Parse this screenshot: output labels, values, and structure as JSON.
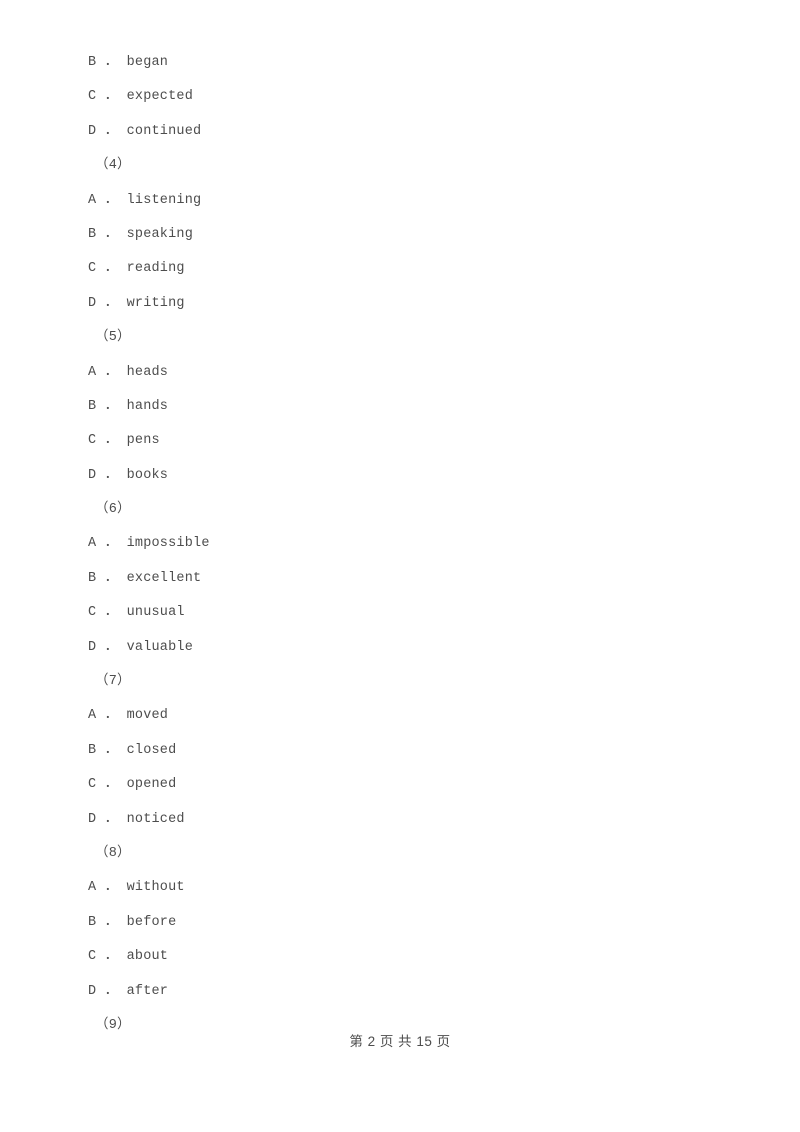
{
  "document": {
    "page_background": "#ffffff",
    "text_color": "#4d4d4d",
    "lines": [
      {
        "kind": "option",
        "text": "B ． began"
      },
      {
        "kind": "option",
        "text": "C ． expected"
      },
      {
        "kind": "option",
        "text": "D ． continued"
      },
      {
        "kind": "qnum",
        "text": "（4）"
      },
      {
        "kind": "option",
        "text": "A ． listening"
      },
      {
        "kind": "option",
        "text": "B ． speaking"
      },
      {
        "kind": "option",
        "text": "C ． reading"
      },
      {
        "kind": "option",
        "text": "D ． writing"
      },
      {
        "kind": "qnum",
        "text": "（5）"
      },
      {
        "kind": "option",
        "text": "A ． heads"
      },
      {
        "kind": "option",
        "text": "B ． hands"
      },
      {
        "kind": "option",
        "text": "C ． pens"
      },
      {
        "kind": "option",
        "text": "D ． books"
      },
      {
        "kind": "qnum",
        "text": "（6）"
      },
      {
        "kind": "option",
        "text": "A ． impossible"
      },
      {
        "kind": "option",
        "text": "B ． excellent"
      },
      {
        "kind": "option",
        "text": "C ． unusual"
      },
      {
        "kind": "option",
        "text": "D ． valuable"
      },
      {
        "kind": "qnum",
        "text": "（7）"
      },
      {
        "kind": "option",
        "text": "A ． moved"
      },
      {
        "kind": "option",
        "text": "B ． closed"
      },
      {
        "kind": "option",
        "text": "C ． opened"
      },
      {
        "kind": "option",
        "text": "D ． noticed"
      },
      {
        "kind": "qnum",
        "text": "（8）"
      },
      {
        "kind": "option",
        "text": "A ． without"
      },
      {
        "kind": "option",
        "text": "B ． before"
      },
      {
        "kind": "option",
        "text": "C ． about"
      },
      {
        "kind": "option",
        "text": "D ． after"
      },
      {
        "kind": "qnum",
        "text": "（9）"
      }
    ],
    "footer": {
      "text": "第 2 页 共 15 页",
      "current_page": "2",
      "total_pages": "15"
    }
  }
}
